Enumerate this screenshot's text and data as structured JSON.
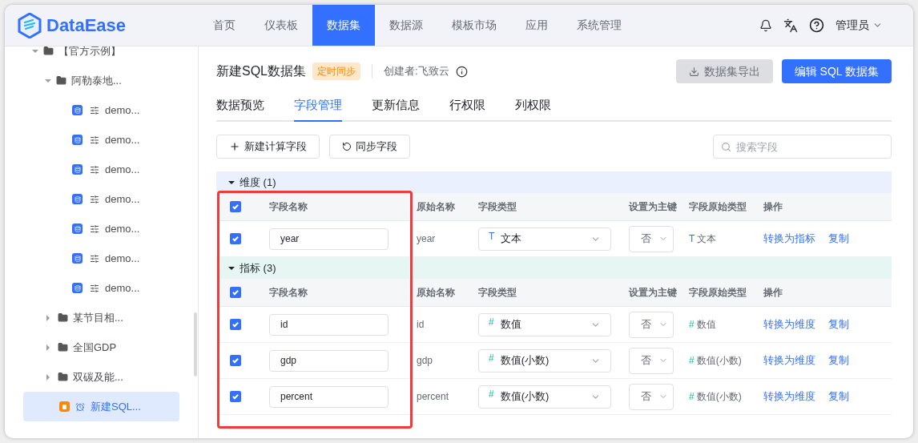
{
  "logo": {
    "text": "DataEase"
  },
  "nav": [
    {
      "label": "首页",
      "selected": false
    },
    {
      "label": "仪表板",
      "selected": false
    },
    {
      "label": "数据集",
      "selected": true
    },
    {
      "label": "数据源",
      "selected": false
    },
    {
      "label": "模板市场",
      "selected": false
    },
    {
      "label": "应用",
      "selected": false
    },
    {
      "label": "系统管理",
      "selected": false
    }
  ],
  "user": {
    "name": "管理员"
  },
  "sidebar": {
    "tree": [
      {
        "label": "【官方示例】",
        "kind": "folder",
        "expanded": true,
        "children": [
          {
            "label": "阿勒泰地...",
            "kind": "folder",
            "expanded": true,
            "children": [
              {
                "label": "demo...",
                "kind": "direct",
                "selected": false
              },
              {
                "label": "demo...",
                "kind": "direct",
                "selected": false
              },
              {
                "label": "demo...",
                "kind": "direct",
                "selected": false
              },
              {
                "label": "demo...",
                "kind": "direct",
                "selected": false
              },
              {
                "label": "demo...",
                "kind": "direct",
                "selected": false
              },
              {
                "label": "demo...",
                "kind": "direct",
                "selected": false
              },
              {
                "label": "demo...",
                "kind": "direct",
                "selected": false
              }
            ]
          },
          {
            "label": "某节目相...",
            "kind": "folder",
            "expanded": false
          },
          {
            "label": "全国GDP",
            "kind": "folder",
            "expanded": false
          },
          {
            "label": "双碳及能...",
            "kind": "folder",
            "expanded": false
          },
          {
            "label": "新建SQL...",
            "kind": "scheduled",
            "selected": true
          }
        ]
      }
    ]
  },
  "dataset": {
    "title": "新建SQL数据集",
    "tag": "定时同步",
    "creator": "创建者:飞致云",
    "buttons": [
      {
        "label": "数据集导出",
        "kind": "export",
        "disabled": true
      },
      {
        "label": "编辑 SQL 数据集",
        "kind": "primary",
        "disabled": false
      }
    ]
  },
  "tabs": [
    {
      "label": "数据预览",
      "selected": false
    },
    {
      "label": "字段管理",
      "selected": true
    },
    {
      "label": "更新信息",
      "selected": false
    },
    {
      "label": "行权限",
      "selected": false
    },
    {
      "label": "列权限",
      "selected": false
    }
  ],
  "toolbar": {
    "buttons": [
      {
        "label": "新建计算字段",
        "kind": "add"
      },
      {
        "label": "同步字段",
        "kind": "sync"
      }
    ],
    "search": {
      "placeholder": "搜索字段"
    }
  },
  "groups": [
    {
      "title": "维度 (1)",
      "kind": "dimension",
      "expanded": true,
      "all_checked": true,
      "columns": [
        "字段名称",
        "原始名称",
        "字段类型",
        "设置为主键",
        "字段原始类型",
        "操作"
      ],
      "rows": [
        {
          "checked": true,
          "name": "year",
          "original": "year",
          "type": {
            "kind": "text",
            "symbol": "T",
            "label": "文本"
          },
          "primary_key": "否",
          "original_type": {
            "kind": "text",
            "symbol": "T",
            "label": "文本"
          },
          "actions": [
            "转换为指标",
            "复制"
          ]
        }
      ]
    },
    {
      "title": "指标 (3)",
      "kind": "measure",
      "expanded": true,
      "all_checked": true,
      "columns": [
        "字段名称",
        "原始名称",
        "字段类型",
        "设置为主键",
        "字段原始类型",
        "操作"
      ],
      "rows": [
        {
          "checked": true,
          "name": "id",
          "original": "id",
          "type": {
            "kind": "number",
            "symbol": "#",
            "label": "数值"
          },
          "primary_key": "否",
          "original_type": {
            "kind": "number",
            "symbol": "#",
            "label": "数值"
          },
          "actions": [
            "转换为维度",
            "复制"
          ]
        },
        {
          "checked": true,
          "name": "gdp",
          "original": "gdp",
          "type": {
            "kind": "number",
            "symbol": "#",
            "label": "数值(小数)"
          },
          "primary_key": "否",
          "original_type": {
            "kind": "number",
            "symbol": "#",
            "label": "数值(小数)"
          },
          "actions": [
            "转换为维度",
            "复制"
          ]
        },
        {
          "checked": true,
          "name": "percent",
          "original": "percent",
          "type": {
            "kind": "number",
            "symbol": "#",
            "label": "数值(小数)"
          },
          "primary_key": "否",
          "original_type": {
            "kind": "number",
            "symbol": "#",
            "label": "数值(小数)"
          },
          "actions": [
            "转换为维度",
            "复制"
          ]
        }
      ]
    }
  ]
}
